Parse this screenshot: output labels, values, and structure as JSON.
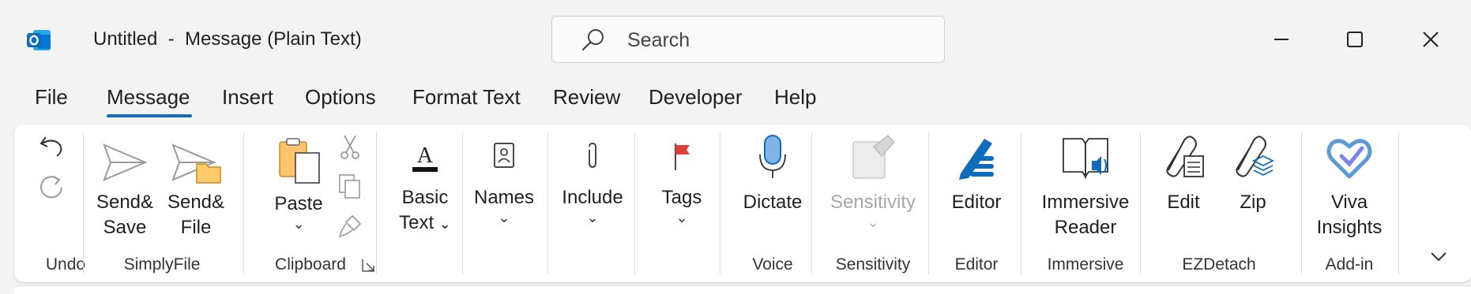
{
  "title_bar": {
    "title": "Untitled  -  Message (Plain Text)",
    "search_placeholder": "Search",
    "app_icon": "outlook-icon",
    "window_controls": [
      "minimize-icon",
      "maximize-icon",
      "close-icon"
    ]
  },
  "tabs": [
    {
      "label": "File"
    },
    {
      "label": "Message",
      "active": true
    },
    {
      "label": "Insert"
    },
    {
      "label": "Options"
    },
    {
      "label": "Format Text"
    },
    {
      "label": "Review"
    },
    {
      "label": "Developer"
    },
    {
      "label": "Help"
    }
  ],
  "ribbon": {
    "groups": {
      "undo": "Undo",
      "simplyfile": "SimplyFile",
      "clipboard": "Clipboard",
      "voice": "Voice",
      "sensitivity": "Sensitivity",
      "editor": "Editor",
      "immersive": "Immersive",
      "ezdetach": "EZDetach",
      "addin": "Add-in"
    },
    "buttons": {
      "send_save_1": "Send&",
      "send_save_2": "Save",
      "send_file_1": "Send&",
      "send_file_2": "File",
      "paste": "Paste",
      "basic_text_1": "Basic",
      "basic_text_2": "Text",
      "names": "Names",
      "include": "Include",
      "tags": "Tags",
      "dictate": "Dictate",
      "sensitivity": "Sensitivity",
      "editor": "Editor",
      "immersive_1": "Immersive",
      "immersive_2": "Reader",
      "edit": "Edit",
      "zip": "Zip",
      "viva_1": "Viva",
      "viva_2": "Insights"
    },
    "chevron": "⌄"
  },
  "colors": {
    "accent": "#0f6cbd",
    "ribbon_bg": "#ffffff",
    "window_bg": "#f3f3f3"
  }
}
